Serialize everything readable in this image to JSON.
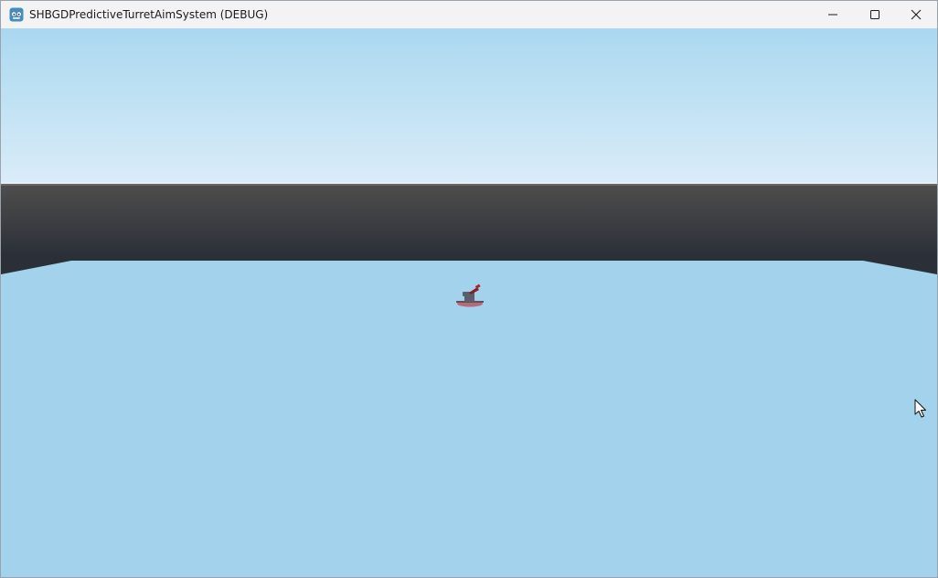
{
  "window": {
    "title": "SHBGDPredictiveTurretAimSystem (DEBUG)",
    "app_icon": "godot-engine-icon",
    "controls": {
      "minimize": "minimize-icon",
      "maximize": "maximize-icon",
      "close": "close-icon"
    }
  },
  "scene": {
    "sky_colors": [
      "#aad8f0",
      "#daecf8"
    ],
    "wall_colors": [
      "#4f4e4d",
      "#2b3038"
    ],
    "floor_color": "#a3d2ec",
    "turret_colors": {
      "base": "#5a5f6c",
      "pad": "#b46a78",
      "barrel": "#8c1c26"
    },
    "cursor": "arrow-cursor-icon"
  }
}
